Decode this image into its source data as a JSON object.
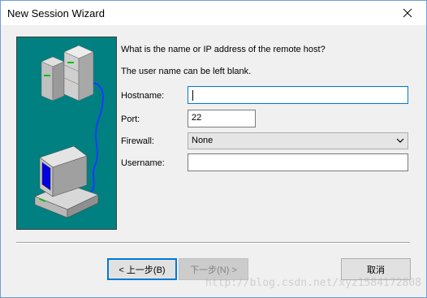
{
  "window": {
    "title": "New Session Wizard"
  },
  "prompt": {
    "line1": "What is the name or IP address of the remote host?",
    "line2": "The user name can be left blank."
  },
  "fields": {
    "hostname_label": "Hostname:",
    "hostname_value": "",
    "port_label": "Port:",
    "port_value": "22",
    "firewall_label": "Firewall:",
    "firewall_value": "None",
    "username_label": "Username:",
    "username_value": ""
  },
  "buttons": {
    "back": "< 上一步(B)",
    "next": "下一步(N) >",
    "cancel": "取消"
  },
  "watermark": "http://blog.csdn.net/xyz1584172808",
  "colors": {
    "illustration_bg": "#008080",
    "accent": "#0078d7"
  },
  "icons": [
    "close-icon",
    "server-icon",
    "computer-icon",
    "chevron-down-icon"
  ]
}
